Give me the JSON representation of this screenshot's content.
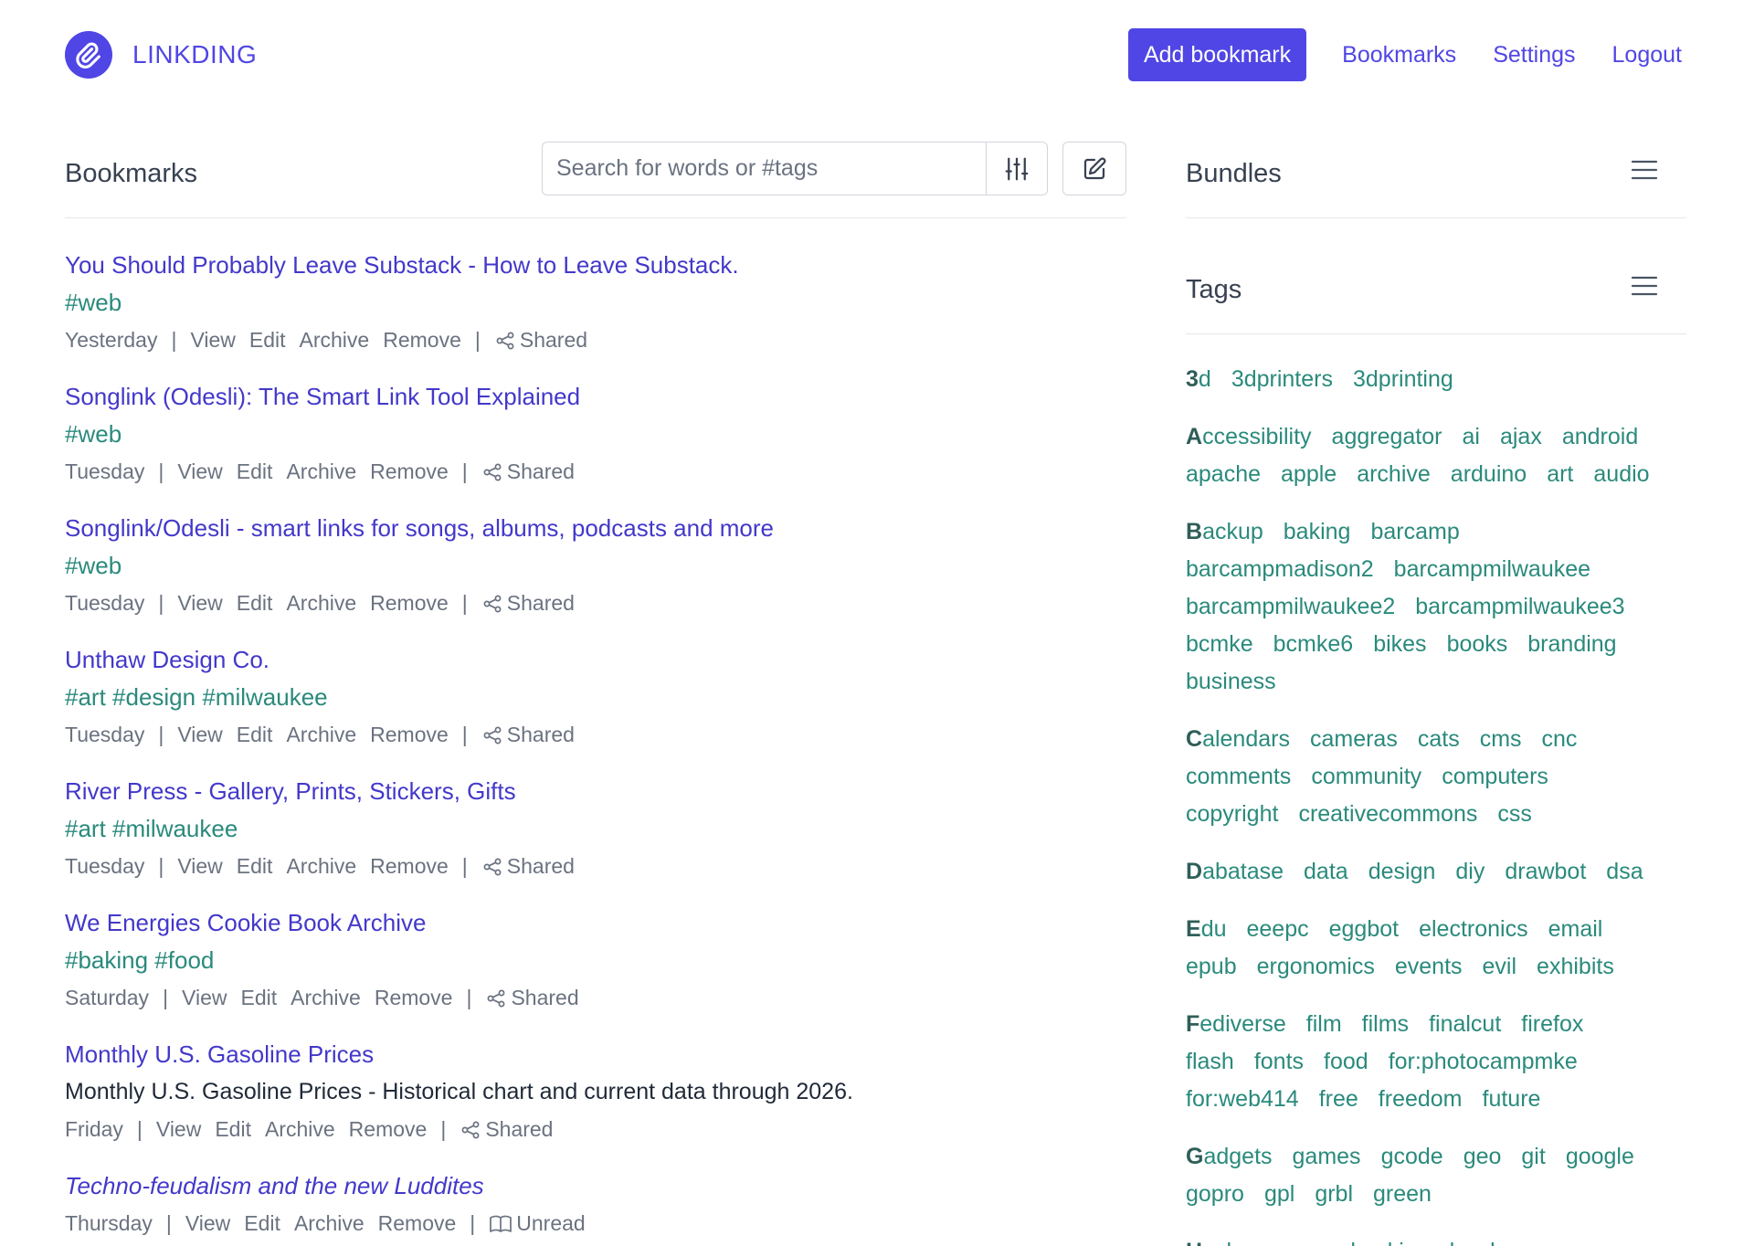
{
  "header": {
    "logo_text": "LINKDING",
    "add_label": "Add bookmark",
    "nav": [
      "Bookmarks",
      "Settings",
      "Logout"
    ]
  },
  "bookmarks_section": {
    "title": "Bookmarks",
    "search_placeholder": "Search for words or #tags"
  },
  "bookmarks": [
    {
      "title": "You Should Probably Leave Substack - How to Leave Substack.",
      "tags": "#web",
      "date": "Yesterday",
      "status": "Shared",
      "unread": false
    },
    {
      "title": "Songlink (Odesli): The Smart Link Tool Explained",
      "tags": "#web",
      "date": "Tuesday",
      "status": "Shared",
      "unread": false
    },
    {
      "title": "Songlink/Odesli - smart links for songs, albums, podcasts and more",
      "tags": "#web",
      "date": "Tuesday",
      "status": "Shared",
      "unread": false
    },
    {
      "title": "Unthaw Design Co.",
      "tags": "#art #design #milwaukee",
      "date": "Tuesday",
      "status": "Shared",
      "unread": false
    },
    {
      "title": "River Press - Gallery, Prints, Stickers, Gifts",
      "tags": "#art #milwaukee",
      "date": "Tuesday",
      "status": "Shared",
      "unread": false
    },
    {
      "title": "We Energies Cookie Book Archive",
      "tags": "#baking #food",
      "date": "Saturday",
      "status": "Shared",
      "unread": false
    },
    {
      "title": "Monthly U.S. Gasoline Prices",
      "description": "Monthly U.S. Gasoline Prices - Historical chart and current data through 2026.",
      "date": "Friday",
      "status": "Shared",
      "unread": false
    },
    {
      "title": "Techno-feudalism and the new Luddites",
      "date": "Thursday",
      "status": "Unread",
      "unread": true
    }
  ],
  "actions": [
    "View",
    "Edit",
    "Archive",
    "Remove"
  ],
  "bundles": {
    "title": "Bundles"
  },
  "tags_section": {
    "title": "Tags",
    "groups": [
      [
        [
          "3d",
          "3dprinters",
          "3dprinting"
        ]
      ],
      [
        [
          "Accessibility",
          "aggregator",
          "ai",
          "ajax",
          "android"
        ],
        [
          "apache",
          "apple",
          "archive",
          "arduino",
          "art",
          "audio"
        ]
      ],
      [
        [
          "Backup",
          "baking",
          "barcamp"
        ],
        [
          "barcampmadison2",
          "barcampmilwaukee"
        ],
        [
          "barcampmilwaukee2",
          "barcampmilwaukee3"
        ],
        [
          "bcmke",
          "bcmke6",
          "bikes",
          "books",
          "branding"
        ],
        [
          "business"
        ]
      ],
      [
        [
          "Calendars",
          "cameras",
          "cats",
          "cms",
          "cnc"
        ],
        [
          "comments",
          "community",
          "computers"
        ],
        [
          "copyright",
          "creativecommons",
          "css"
        ]
      ],
      [
        [
          "Dabatase",
          "data",
          "design",
          "diy",
          "drawbot",
          "dsa"
        ]
      ],
      [
        [
          "Edu",
          "eeepc",
          "eggbot",
          "electronics",
          "email"
        ],
        [
          "epub",
          "ergonomics",
          "events",
          "evil",
          "exhibits"
        ]
      ],
      [
        [
          "Fediverse",
          "film",
          "films",
          "finalcut",
          "firefox"
        ],
        [
          "flash",
          "fonts",
          "food",
          "for:photocampmke"
        ],
        [
          "for:web414",
          "free",
          "freedom",
          "future"
        ]
      ],
      [
        [
          "Gadgets",
          "games",
          "gcode",
          "geo",
          "git",
          "google"
        ],
        [
          "gopro",
          "gpl",
          "grbl",
          "green"
        ]
      ],
      [
        [
          "Hackerspaces",
          "hacking",
          "hardcore"
        ]
      ]
    ]
  },
  "colors": {
    "accent": "#5046e5",
    "link": "#4338ca",
    "tag": "#2a8a7c",
    "muted": "#6b7280"
  }
}
